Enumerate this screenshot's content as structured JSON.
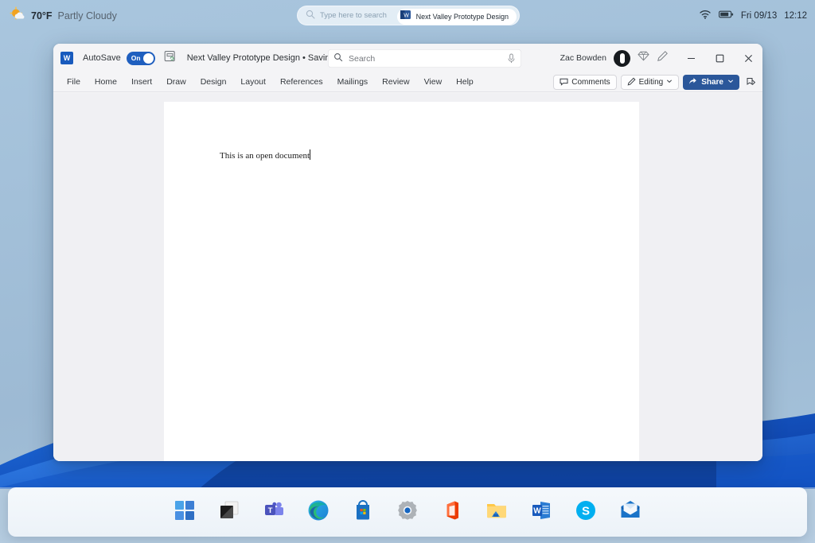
{
  "desktop": {
    "weather": {
      "icon": "partly-cloudy-icon",
      "temp": "70°F",
      "desc": "Partly Cloudy"
    },
    "search": {
      "icon": "search-icon",
      "placeholder": "Type here to search",
      "task_pill": {
        "icon": "word-app-icon",
        "label": "Next Valley Prototype Design"
      }
    },
    "tray": {
      "wifi_icon": "wifi-icon",
      "battery_icon": "battery-icon",
      "date": "Fri 09/13",
      "time": "12:12"
    }
  },
  "word": {
    "titlebar": {
      "app_icon": "word-app-icon",
      "autosave_label": "AutoSave",
      "autosave_state": "On",
      "save_icon": "save-sync-icon",
      "document_title": "Next Valley Prototype Design • Saving...",
      "title_chevron": "chevron-down-icon",
      "search_placeholder": "Search",
      "search_icon": "search-icon",
      "mic_icon": "microphone-icon",
      "user_name": "Zac Bowden",
      "avatar": "user-avatar",
      "copilot_icon": "diamond-copilot-icon",
      "pen_icon": "pen-icon",
      "minimize": "minimize-icon",
      "maximize": "maximize-icon",
      "close": "close-icon"
    },
    "ribbon": {
      "tabs": [
        {
          "label": "File"
        },
        {
          "label": "Home"
        },
        {
          "label": "Insert"
        },
        {
          "label": "Draw"
        },
        {
          "label": "Design"
        },
        {
          "label": "Layout"
        },
        {
          "label": "References"
        },
        {
          "label": "Mailings"
        },
        {
          "label": "Review"
        },
        {
          "label": "View"
        },
        {
          "label": "Help"
        }
      ],
      "comments_label": "Comments",
      "comments_icon": "comment-bubble-icon",
      "editing_label": "Editing",
      "editing_icon": "pen-icon",
      "editing_chevron": "chevron-down-icon",
      "share_label": "Share",
      "share_icon": "share-icon",
      "share_chevron": "chevron-down-icon",
      "ribbon_display_icon": "ribbon-display-options-icon"
    },
    "document": {
      "body_text": "This is an open document"
    }
  },
  "taskbar": {
    "items": [
      {
        "name": "start-button",
        "icon": "windows-start-icon",
        "label": "Start"
      },
      {
        "name": "task-view-button",
        "icon": "task-view-icon",
        "label": "Task View"
      },
      {
        "name": "teams-button",
        "icon": "teams-icon",
        "label": "Microsoft Teams"
      },
      {
        "name": "edge-button",
        "icon": "edge-icon",
        "label": "Microsoft Edge"
      },
      {
        "name": "store-button",
        "icon": "microsoft-store-icon",
        "label": "Microsoft Store"
      },
      {
        "name": "settings-button",
        "icon": "settings-gear-icon",
        "label": "Settings"
      },
      {
        "name": "office-button",
        "icon": "office-icon",
        "label": "Office"
      },
      {
        "name": "file-explorer-button",
        "icon": "file-explorer-icon",
        "label": "File Explorer"
      },
      {
        "name": "word-button",
        "icon": "word-icon",
        "label": "Word"
      },
      {
        "name": "skype-button",
        "icon": "skype-icon",
        "label": "Skype"
      },
      {
        "name": "mail-button",
        "icon": "mail-icon",
        "label": "Mail"
      }
    ]
  },
  "colors": {
    "accent_blue": "#2b579a",
    "toggle_on": "#1f5fbf",
    "word_blue": "#185abd",
    "desktop_blue": "#a3c0d9"
  }
}
